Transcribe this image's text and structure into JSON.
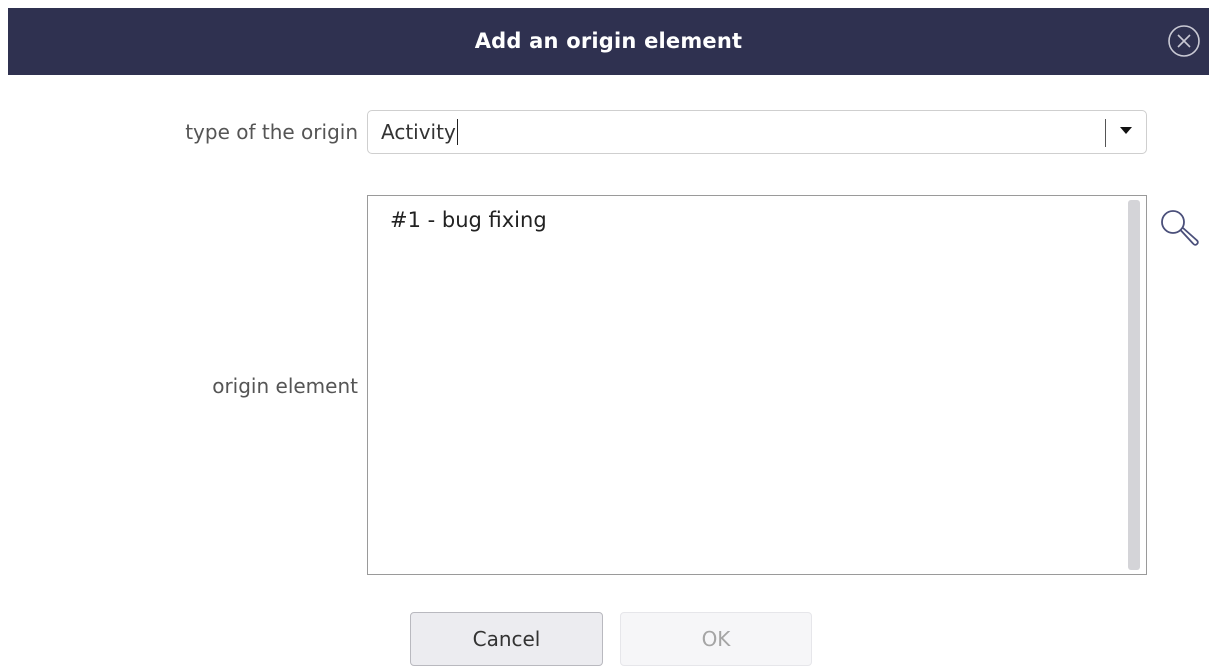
{
  "dialog": {
    "title": "Add an origin element"
  },
  "form": {
    "type_label": "type of the origin",
    "type_value": "Activity",
    "origin_label": "origin element",
    "origin_items": [
      "#1 - bug fixing"
    ]
  },
  "buttons": {
    "cancel_label": "Cancel",
    "ok_label": "OK"
  },
  "icons": {
    "close": "close-circle-icon",
    "dropdown": "triangle-down-icon",
    "search": "search-icon"
  },
  "colors": {
    "titlebar": "#2f3150",
    "title_text": "#ffffff",
    "label_text": "#555555",
    "ok_disabled_text": "#a5a5a5"
  }
}
